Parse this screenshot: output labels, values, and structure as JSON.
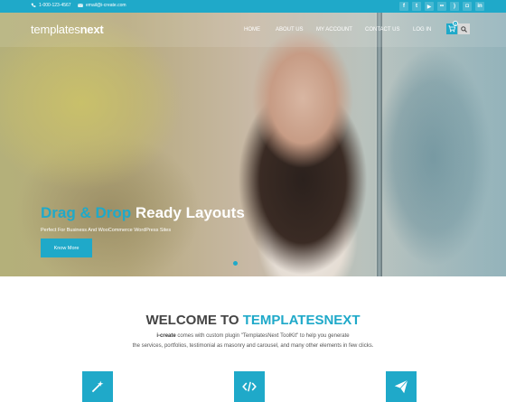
{
  "topbar": {
    "phone": "1-000-123-4567",
    "email": "email@i-create.com",
    "social_icons": [
      "facebook-icon",
      "twitter-icon",
      "youtube-icon",
      "flickr-icon",
      "rss-icon",
      "instagram-icon",
      "linkedin-icon"
    ]
  },
  "header": {
    "logo_light": "templates",
    "logo_bold": "next",
    "nav": [
      "HOME",
      "ABOUT US",
      "MY ACCOUNT",
      "CONTACT US",
      "LOG IN"
    ],
    "cart_count": "0"
  },
  "hero": {
    "headline_accent": "Drag & Drop",
    "headline_rest": "Ready Layouts",
    "subline": "Perfect For Business And WooCommerce WordPress Sites",
    "button_label": "Know More"
  },
  "welcome": {
    "title_plain": "WELCOME TO",
    "title_accent": "TEMPLATESNEXT",
    "line1_bold": "i-create",
    "line1_rest": "comes with custom plugin \"TemplatesNext ToolKit\" to help you generate",
    "line2": "the services, portfolios, testimonial as masonry and carousel, and many other elements in few clicks."
  },
  "features": [
    "magic-wand-icon",
    "code-icon",
    "paper-plane-icon"
  ],
  "colors": {
    "accent": "#1fa9c9"
  }
}
